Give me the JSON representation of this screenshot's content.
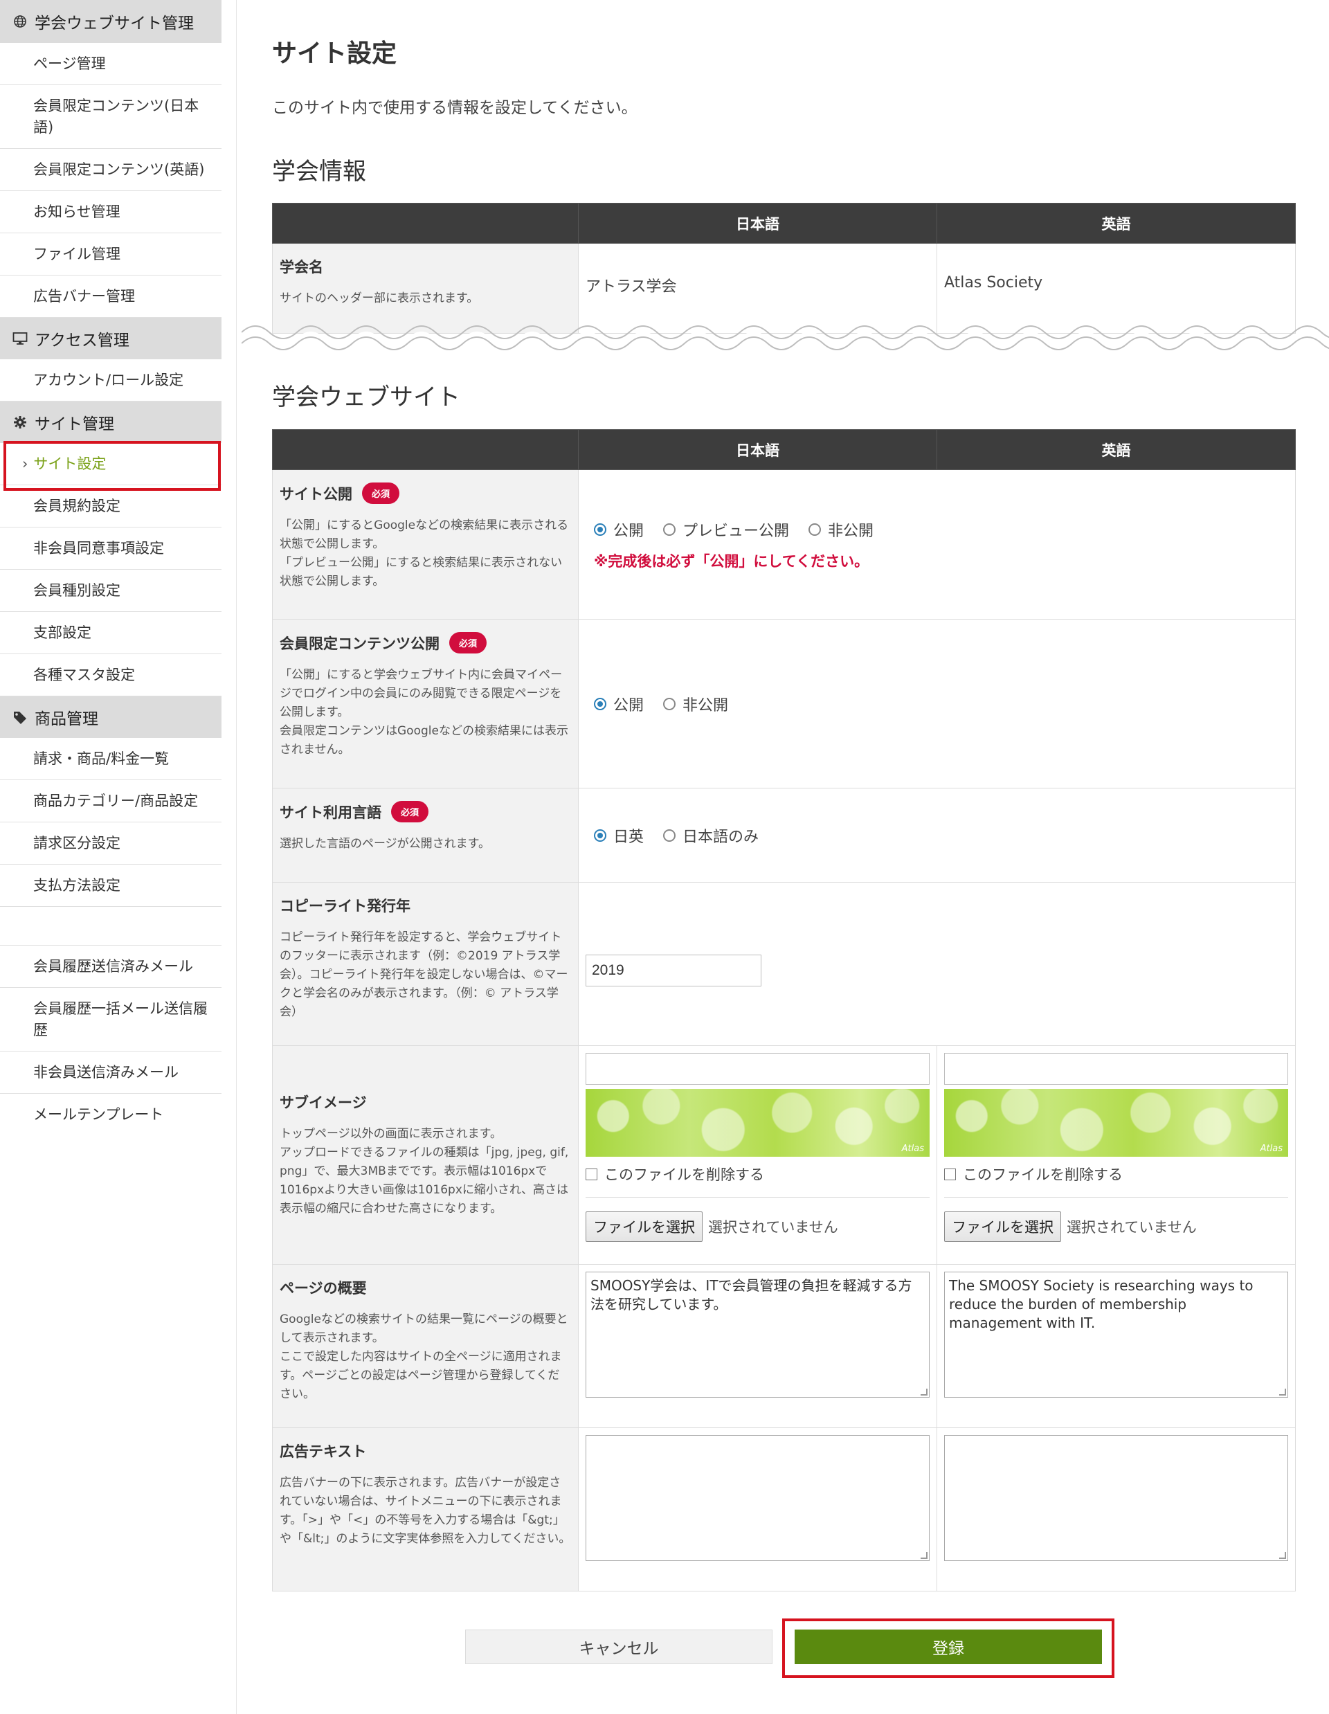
{
  "sidebar": {
    "sections": [
      {
        "label": "学会ウェブサイト管理",
        "icon": "globe-icon",
        "items": [
          "ページ管理",
          "会員限定コンテンツ(日本語)",
          "会員限定コンテンツ(英語)",
          "お知らせ管理",
          "ファイル管理",
          "広告バナー管理"
        ]
      },
      {
        "label": "アクセス管理",
        "icon": "monitor-icon",
        "items": [
          "アカウント/ロール設定"
        ]
      },
      {
        "label": "サイト管理",
        "icon": "gear-icon",
        "items": [
          "サイト設定",
          "会員規約設定",
          "非会員同意事項設定",
          "会員種別設定",
          "支部設定",
          "各種マスタ設定"
        ]
      },
      {
        "label": "商品管理",
        "icon": "tag-icon",
        "items": [
          "請求・商品/料金一覧",
          "商品カテゴリー/商品設定",
          "請求区分設定",
          "支払方法設定",
          "",
          "会員履歴送信済みメール",
          "会員履歴一括メール送信履歴",
          "非会員送信済みメール",
          "メールテンプレート"
        ]
      }
    ],
    "active_item": "サイト設定"
  },
  "page": {
    "title": "サイト設定",
    "description": "このサイト内で使用する情報を設定してください。"
  },
  "society_info": {
    "title": "学会情報",
    "col_ja": "日本語",
    "col_en": "英語",
    "name_label": "学会名",
    "name_desc": "サイトのヘッダー部に表示されます。",
    "name_ja": "アトラス学会",
    "name_en": "Atlas Society"
  },
  "website": {
    "title": "学会ウェブサイト",
    "col_ja": "日本語",
    "col_en": "英語",
    "required_badge": "必須",
    "publish": {
      "label": "サイト公開",
      "desc": "「公開」にするとGoogleなどの検索結果に表示される状態で公開します。\n「プレビュー公開」にすると検索結果に表示されない状態で公開します。",
      "options": [
        "公開",
        "プレビュー公開",
        "非公開"
      ],
      "selected": "公開",
      "warning": "※完成後は必ず「公開」にしてください。"
    },
    "member_content": {
      "label": "会員限定コンテンツ公開",
      "desc": "「公開」にすると学会ウェブサイト内に会員マイページでログイン中の会員にのみ閲覧できる限定ページを公開します。\n会員限定コンテンツはGoogleなどの検索結果には表示されません。",
      "options": [
        "公開",
        "非公開"
      ],
      "selected": "公開"
    },
    "language": {
      "label": "サイト利用言語",
      "desc": "選択した言語のページが公開されます。",
      "options": [
        "日英",
        "日本語のみ"
      ],
      "selected": "日英"
    },
    "copyright": {
      "label": "コピーライト発行年",
      "desc": "コピーライト発行年を設定すると、学会ウェブサイトのフッターに表示されます（例：©2019 アトラス学会）。コピーライト発行年を設定しない場合は、©マークと学会名のみが表示されます。（例：© アトラス学会）",
      "value": "2019"
    },
    "sub_image": {
      "label": "サブイメージ",
      "desc": "トップページ以外の画面に表示されます。\nアップロードできるファイルの種類は「jpg, jpeg, gif, png」で、最大3MBまでです。表示幅は1016pxで1016pxより大きい画像は1016pxに縮小され、高さは表示幅の縮尺に合わせた高さになります。",
      "delete_label": "このファイルを削除する",
      "file_button": "ファイルを選択",
      "no_file": "選択されていません",
      "thumb_mark": "Atlas"
    },
    "overview": {
      "label": "ページの概要",
      "desc": "Googleなどの検索サイトの結果一覧にページの概要として表示されます。\nここで設定した内容はサイトの全ページに適用されます。ページごとの設定はページ管理から登録してください。",
      "value_ja": "SMOOSY学会は、ITで会員管理の負担を軽減する方法を研究しています。",
      "value_en": "The SMOOSY Society is researching ways to reduce the burden of membership management with IT."
    },
    "ad_text": {
      "label": "広告テキスト",
      "desc": "広告バナーの下に表示されます。広告バナーが設定されていない場合は、サイトメニューの下に表示されます。「>」や「<」の不等号を入力する場合は「&gt;」や「&lt;」のように文字実体参照を入力してください。",
      "value_ja": "",
      "value_en": ""
    }
  },
  "buttons": {
    "cancel": "キャンセル",
    "submit": "登録"
  },
  "colors": {
    "header_bg": "#3d3d3d",
    "required": "#d10d3d",
    "submit": "#5a8a0f",
    "active_menu": "#7ba21a",
    "highlight": "#d6131f"
  }
}
